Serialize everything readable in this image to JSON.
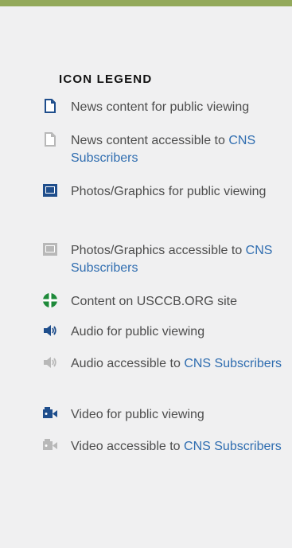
{
  "legend": {
    "title": "ICON LEGEND",
    "items": [
      {
        "icon": "news-icon",
        "text": "News content for public viewing",
        "link": ""
      },
      {
        "icon": "news-subscriber-icon",
        "text": "News content accessible to ",
        "link": "CNS Subscribers"
      },
      {
        "icon": "photo-icon",
        "text": "Photos/Graphics for public viewing",
        "link": ""
      },
      {
        "icon": "photo-subscriber-icon",
        "text": "Photos/Graphics accessible to ",
        "link": "CNS Subscribers"
      },
      {
        "icon": "globe-icon",
        "text": "Content on USCCB.ORG site",
        "link": ""
      },
      {
        "icon": "audio-icon",
        "text": "Audio for public viewing",
        "link": ""
      },
      {
        "icon": "audio-subscriber-icon",
        "text": "Audio accessible to ",
        "link": "CNS Subscribers"
      },
      {
        "icon": "video-icon",
        "text": "Video for public viewing",
        "link": ""
      },
      {
        "icon": "video-subscriber-icon",
        "text": "Video accessible to ",
        "link": "CNS Subscribers"
      }
    ]
  },
  "colors": {
    "top_bar": "#93a95b",
    "panel_bg": "#f0f0f1",
    "link": "#2f6db0",
    "icon_primary": "#1f4e8c",
    "icon_green": "#1e8a3a",
    "icon_gray": "#b8b8b8"
  }
}
